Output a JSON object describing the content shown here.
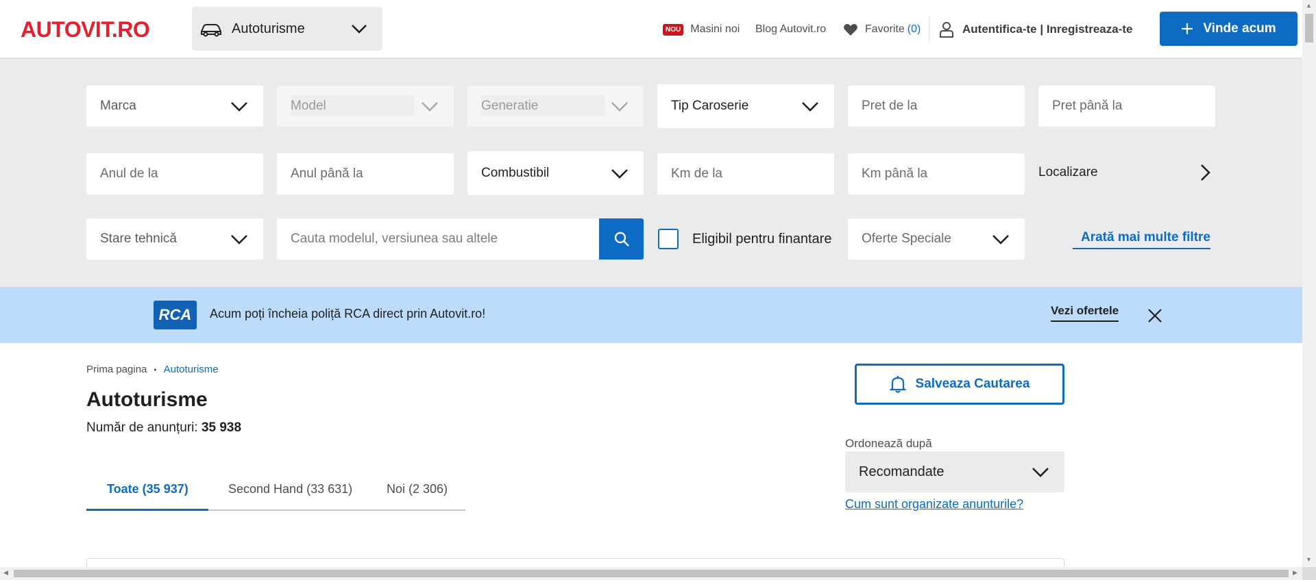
{
  "header": {
    "logo": "AUTOVIT.RO",
    "category": "Autoturisme",
    "nav": {
      "new_badge": "NOU",
      "new_cars": "Masini noi",
      "blog": "Blog Autovit.ro",
      "favorites": "Favorite",
      "favorites_count": "(0)",
      "auth": "Autentifica-te | Inregistreaza-te"
    },
    "sell_button": "Vinde acum"
  },
  "filters": {
    "brand": "Marca",
    "model": "Model",
    "generation": "Generatie",
    "body_type": "Tip Caroserie",
    "price_from": "Pret de la",
    "price_to": "Pret până la",
    "year_from": "Anul de la",
    "year_to": "Anul până la",
    "fuel": "Combustibil",
    "km_from": "Km de la",
    "km_to": "Km până la",
    "location": "Localizare",
    "condition": "Stare tehnică",
    "search_placeholder": "Cauta modelul, versiunea sau altele",
    "financing": "Eligibil pentru finantare",
    "special_offers": "Oferte Speciale",
    "more_filters": "Arată mai multe filtre"
  },
  "banner": {
    "logo": "RCA",
    "text": "Acum poți încheia poliță RCA direct prin Autovit.ro!",
    "link": "Vezi ofertele"
  },
  "main": {
    "breadcrumb": [
      "Prima pagina",
      "Autoturisme"
    ],
    "title": "Autoturisme",
    "count_label": "Număr de anunțuri:",
    "count_value": "35 938",
    "tabs": [
      {
        "label": "Toate (35 937)",
        "active": true
      },
      {
        "label": "Second Hand (33 631)",
        "active": false
      },
      {
        "label": "Noi (2 306)",
        "active": false
      }
    ],
    "save_search": "Salveaza Cautarea",
    "sort_label": "Ordonează după",
    "sort_value": "Recomandate",
    "sort_help": "Cum sunt organizate anunturile?"
  },
  "colors": {
    "brand_red": "#e4202f",
    "accent_blue": "#0e6bc4",
    "filter_bg": "#ebebee",
    "banner_bg": "#bddcfb"
  }
}
